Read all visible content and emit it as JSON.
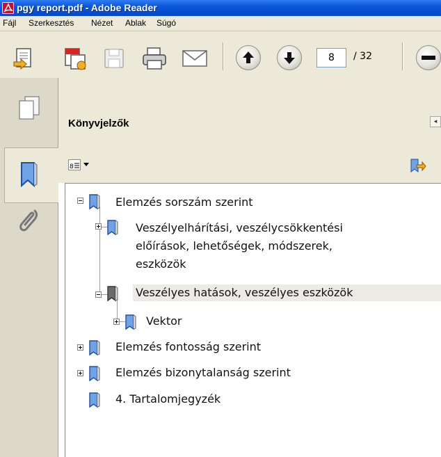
{
  "window": {
    "title": "pgy report.pdf - Adobe Reader"
  },
  "menu": [
    "Fájl",
    "Szerkesztés",
    "Nézet",
    "Ablak",
    "Súgó"
  ],
  "toolbar": {
    "current_page": "8",
    "total_pages": "/ 32"
  },
  "panel": {
    "title": "Könyvjelzők"
  },
  "bookmarks": [
    {
      "label": "Elemzés sorszám szerint",
      "state": "expanded"
    },
    {
      "label_lines": [
        "Veszélyelhárítási, veszélycsökkentési",
        "előírások, lehetőségek, módszerek,",
        "eszközök"
      ],
      "state": "collapsed"
    },
    {
      "label": "Veszélyes hatások, veszélyes eszközök",
      "state": "expanded",
      "selected": true
    },
    {
      "label": "Vektor",
      "state": "collapsed"
    },
    {
      "label": "Elemzés fontosság szerint",
      "state": "collapsed"
    },
    {
      "label": "Elemzés bizonytalanság szerint",
      "state": "collapsed"
    },
    {
      "label": "4. Tartalomjegyzék",
      "state": "leaf"
    }
  ],
  "colors": {
    "titlebar": "#0a56d6",
    "chrome": "#ece9d8",
    "bookmark_icon": "#2f6fd0",
    "selected_row": "#ecebe6"
  }
}
